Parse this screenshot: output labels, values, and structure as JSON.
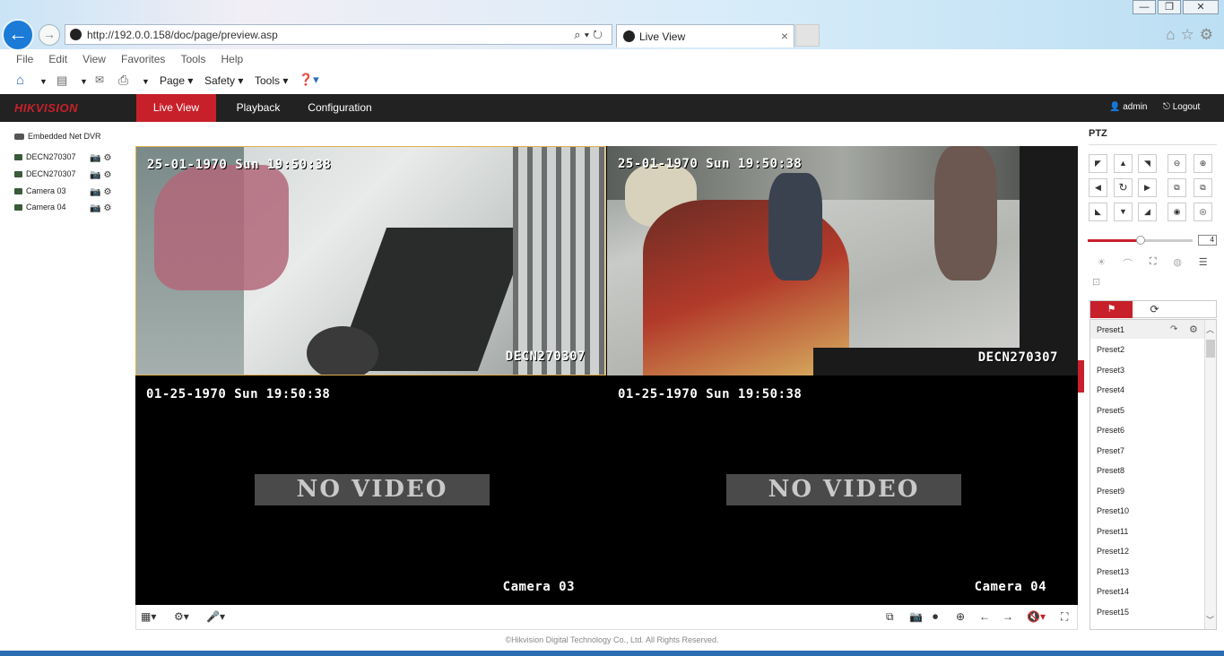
{
  "browser": {
    "address_url": "http://192.0.0.158/doc/page/preview.asp",
    "tab_title": "Live View",
    "menu": [
      "File",
      "Edit",
      "View",
      "Favorites",
      "Tools",
      "Help"
    ],
    "command_bar": {
      "page": "Page ▾",
      "safety": "Safety ▾",
      "tools": "Tools ▾"
    }
  },
  "app": {
    "logo": "HIKVISION",
    "nav": {
      "live_view": "Live View",
      "playback": "Playback",
      "configuration": "Configuration"
    },
    "user": "admin",
    "logout": "Logout",
    "accent_color": "#c8202a"
  },
  "device_tree": {
    "root": "Embedded Net DVR",
    "cameras": [
      "DECN270307",
      "DECN270307",
      "Camera 03",
      "Camera 04"
    ]
  },
  "video": {
    "panes": [
      {
        "date": "25-01-1970 Sun 19:50:38",
        "name": "DECN270307",
        "no_video": ""
      },
      {
        "date": "25-01-1970 Sun 19:50:38",
        "name": "DECN270307",
        "no_video": ""
      },
      {
        "date": "01-25-1970 Sun 19:50:38",
        "name": "Camera 03",
        "no_video": "NO VIDEO"
      },
      {
        "date": "01-25-1970 Sun 19:50:38",
        "name": "Camera 04",
        "no_video": "NO VIDEO"
      }
    ]
  },
  "ptz": {
    "title": "PTZ",
    "speed": "4",
    "speed_fraction": 0.5,
    "presets": [
      "Preset1",
      "Preset2",
      "Preset3",
      "Preset4",
      "Preset5",
      "Preset6",
      "Preset7",
      "Preset8",
      "Preset9",
      "Preset10",
      "Preset11",
      "Preset12",
      "Preset13",
      "Preset14",
      "Preset15"
    ]
  },
  "footer": "©Hikvision Digital Technology Co., Ltd. All Rights Reserved."
}
